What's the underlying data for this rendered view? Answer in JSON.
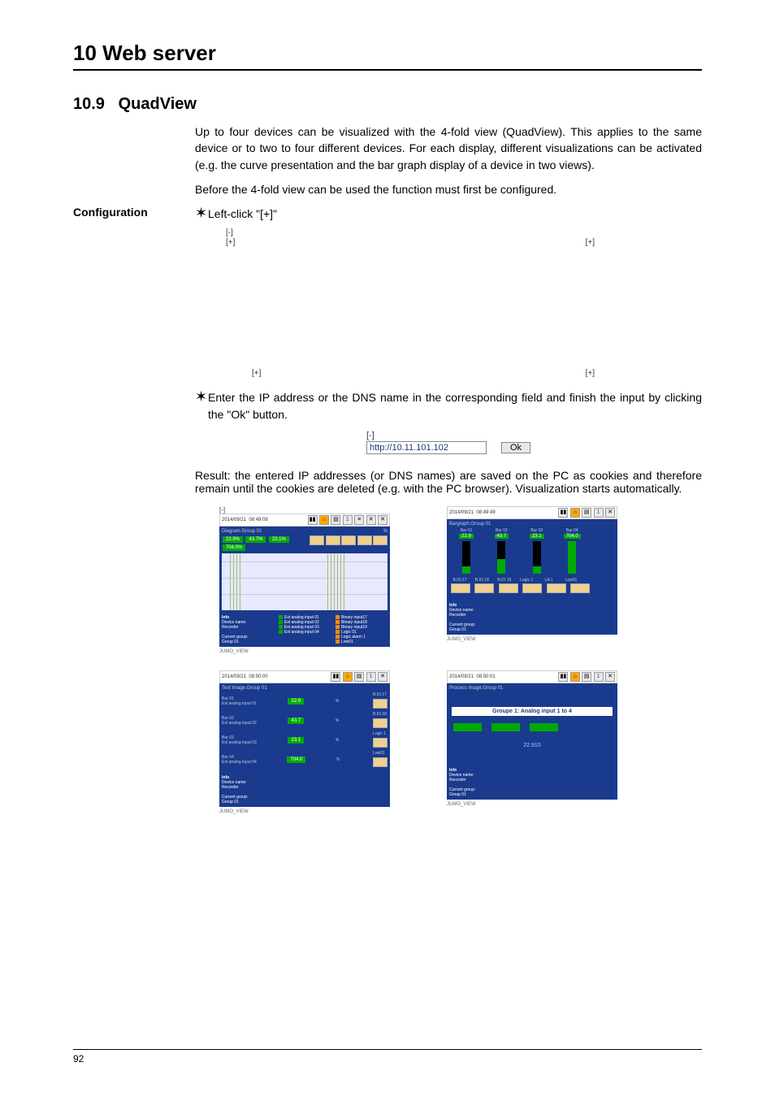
{
  "chapter": {
    "title": "10 Web server"
  },
  "section": {
    "number": "10.9",
    "title": "QuadView"
  },
  "intro": {
    "p1": "Up to four devices can be visualized with the 4-fold view (QuadView). This applies to the same device or to two to four different devices. For each display, different visualizations can be activated (e.g. the curve presentation and the bar graph display of a device in two views).",
    "p2": "Before the 4-fold view can be used the function must first be configured."
  },
  "config": {
    "label": "Configuration",
    "star": "✶",
    "step1": "Left-click \"[+]\"",
    "quad": {
      "minus": "[-]",
      "plus": "[+]"
    },
    "step2": "Enter the IP address or the DNS name in the corresponding field and finish the input by clicking the \"Ok\" button.",
    "ipbox": {
      "minus": "[-]",
      "value": "http://10.11.101.102",
      "ok": "Ok"
    },
    "result": "Result: the entered IP addresses (or DNS names) are saved on the PC as cookies and therefore remain until the cookies are deleted (e.g. with the PC browser). Visualization starts automatically.",
    "thumb": {
      "minus": "[-]",
      "date": "2014/09/21",
      "time1": "08:49:08",
      "time2": "08:49:49",
      "time3": "08:50:00",
      "time4": "08:50:01",
      "diagram_title": "Diagram.Group 01",
      "bargraph_title": "Bargraph.Group 01",
      "textimg_title": "Text image.Group 01",
      "process_title": "Process image.Group 01",
      "percent_sym": "%",
      "one_icon": "1",
      "chips": {
        "a": "22.9%",
        "b": "43.7%",
        "c": "23.1%",
        "d": "704.0%"
      },
      "chip_vals": {
        "a": "22.9",
        "b": "43.7",
        "c": "23.1",
        "d": "704.0"
      },
      "bars": {
        "b1": {
          "name": "Bar 01",
          "val": "22.9"
        },
        "b2": {
          "name": "Bar 02",
          "val": "43.7"
        },
        "b3": {
          "name": "Bar 03",
          "val": "23.1"
        },
        "b4": {
          "name": "Bar 04",
          "val": "704.0"
        }
      },
      "ind": {
        "bio17": "B.IO.17",
        "bio18": "B.IO.18",
        "bio19": "B.IO.19",
        "logic1": "Logic 1",
        "la1": "LA 1",
        "low01": "Low01"
      },
      "info": {
        "heading": "Info",
        "dev_label": "Device name:",
        "dev_val": "Recorder",
        "grp_label": "Current group:",
        "grp_val": "Group 01",
        "legend": {
          "l1": "Ext analog input 01",
          "l2": "Ext analog input 02",
          "l3": "Ext analog input 03",
          "l4": "Ext analog input 04",
          "r1": "Binary input17",
          "r2": "Binary input18",
          "r3": "Binary input19",
          "r4": "Logic 01",
          "r5": "Logic alarm 1",
          "r6": "Low01"
        }
      },
      "textrows": {
        "r1l": "Bar 01\nExt analog input 01",
        "r2l": "Bar 02\nExt analog input 02",
        "r3l": "Bar 03\nExt analog input 03",
        "r4l": "Bar 04\nExt analog input 04"
      },
      "process_label": "Groupe 1: Analog input 1 to 4",
      "process_center": "22.910",
      "footer_ref": "JUMO_VIEW"
    }
  },
  "page_number": "92"
}
